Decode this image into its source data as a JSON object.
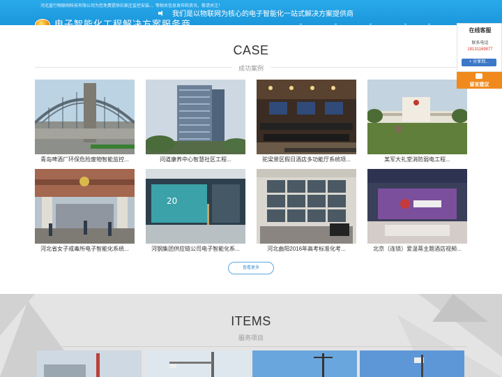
{
  "topbar": {
    "notice": "河北蓝行物联网科技有限公司为您免费提供石家庄监控安装、、等相关信息发布和资讯，敬请关注！",
    "slogan": "我们是以物联网为核心的电子智能化一站式解决方案提供商",
    "logo_text": "电子智能化工程解决方案服务商"
  },
  "case_section": {
    "title": "CASE",
    "subtitle": "成功案例",
    "items": [
      {
        "caption": "青岛啤酒厂环保危险废物智能监控..."
      },
      {
        "caption": "问道康养中心智慧社区工程..."
      },
      {
        "caption": "驼梁景区假日酒店多功能厅系统项..."
      },
      {
        "caption": "某军大礼堂消防弱电工程..."
      },
      {
        "caption": "河北省女子戒毒所电子智能化系统..."
      },
      {
        "caption": "河钢集团供应链公司电子智能化系..."
      },
      {
        "caption": "河北曲阳2016年高考标准化考..."
      },
      {
        "caption": "北京（连锁）爱温蒂主题酒店视频..."
      }
    ],
    "more_label": "查看更多"
  },
  "items_section": {
    "title": "ITEMS",
    "subtitle": "服务项目"
  },
  "float_panel": {
    "title": "在线客服",
    "contact_label": "联系电话",
    "phone": "18131169877",
    "share_label": "分享到...",
    "message_label": "留言建议"
  },
  "colors": {
    "topbar": "#1f9fe2",
    "accent_orange": "#f08a1c",
    "button_border": "#5aa7e0"
  }
}
